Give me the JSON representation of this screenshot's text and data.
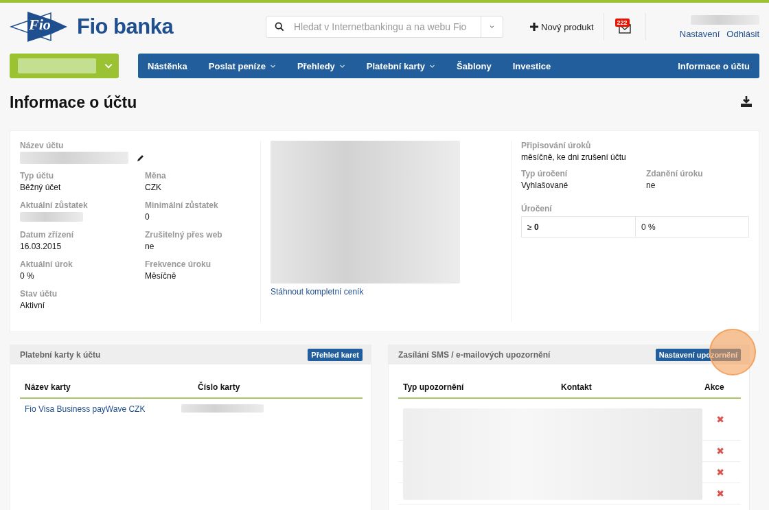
{
  "header": {
    "logo_text": "Fio",
    "brand": "Fio banka",
    "search": {
      "placeholder": "Hledat v Internetbankingu a na webu Fio"
    },
    "new_product": "Nový produkt",
    "messages_badge": "222",
    "user_links": [
      "Nastavení",
      "Odhlásit"
    ]
  },
  "nav": {
    "items": [
      {
        "label": "Nástěnka",
        "has_menu": false
      },
      {
        "label": "Poslat peníze",
        "has_menu": true
      },
      {
        "label": "Přehledy",
        "has_menu": true
      },
      {
        "label": "Platební karty",
        "has_menu": true
      },
      {
        "label": "Šablony",
        "has_menu": false
      },
      {
        "label": "Investice",
        "has_menu": false
      }
    ],
    "right_item": "Informace o účtu"
  },
  "page_title": "Informace o účtu",
  "account": {
    "name_label": "Název účtu",
    "left_fields": [
      {
        "label": "Typ účtu",
        "value": "Běžný účet",
        "redacted": false
      },
      {
        "label": "Měna",
        "value": "CZK",
        "redacted": false
      },
      {
        "label": "Aktuální zůstatek",
        "redacted": true
      },
      {
        "label": "Minimální zůstatek",
        "value": "0",
        "redacted": false
      },
      {
        "label": "Datum zřízení",
        "value": "16.03.2015",
        "redacted": false
      },
      {
        "label": "Zrušitelný přes web",
        "value": "ne",
        "redacted": false
      },
      {
        "label": "Aktuální úrok",
        "value": "0 %",
        "redacted": false
      },
      {
        "label": "Frekvence úroku",
        "value": "Měsíčně",
        "redacted": false
      },
      {
        "label": "Stav účtu",
        "value": "Aktivní",
        "redacted": false
      }
    ],
    "pricing_link": "Stáhnout kompletní ceník",
    "interest_credit": {
      "label": "Připisování úroků",
      "value": "měsíčně, ke dni zrušení účtu"
    },
    "right_fields": [
      {
        "label": "Typ úročení",
        "value": "Vyhlašované"
      },
      {
        "label": "Zdanění úroku",
        "value": "ne"
      }
    ],
    "rates": {
      "label": "Úročení",
      "rows": [
        {
          "threshold": "≥ **0**",
          "rate": "0 %"
        }
      ]
    }
  },
  "cards_panel": {
    "title": "Platební karty k účtu",
    "button": "Přehled karet",
    "columns": [
      "Název karty",
      "Číslo karty"
    ],
    "rows": [
      {
        "name": "Fio Visa Business payWave CZK"
      }
    ]
  },
  "alerts_panel": {
    "title": "Zasílání SMS / e-mailových upozornění",
    "button": "Nastavení upozornění",
    "columns": [
      "Typ upozornění",
      "Kontakt",
      "Akce"
    ],
    "rows": [
      {
        "action": "✖"
      },
      {
        "action": "✖"
      },
      {
        "action": "✖"
      },
      {
        "action": "✖"
      }
    ]
  }
}
